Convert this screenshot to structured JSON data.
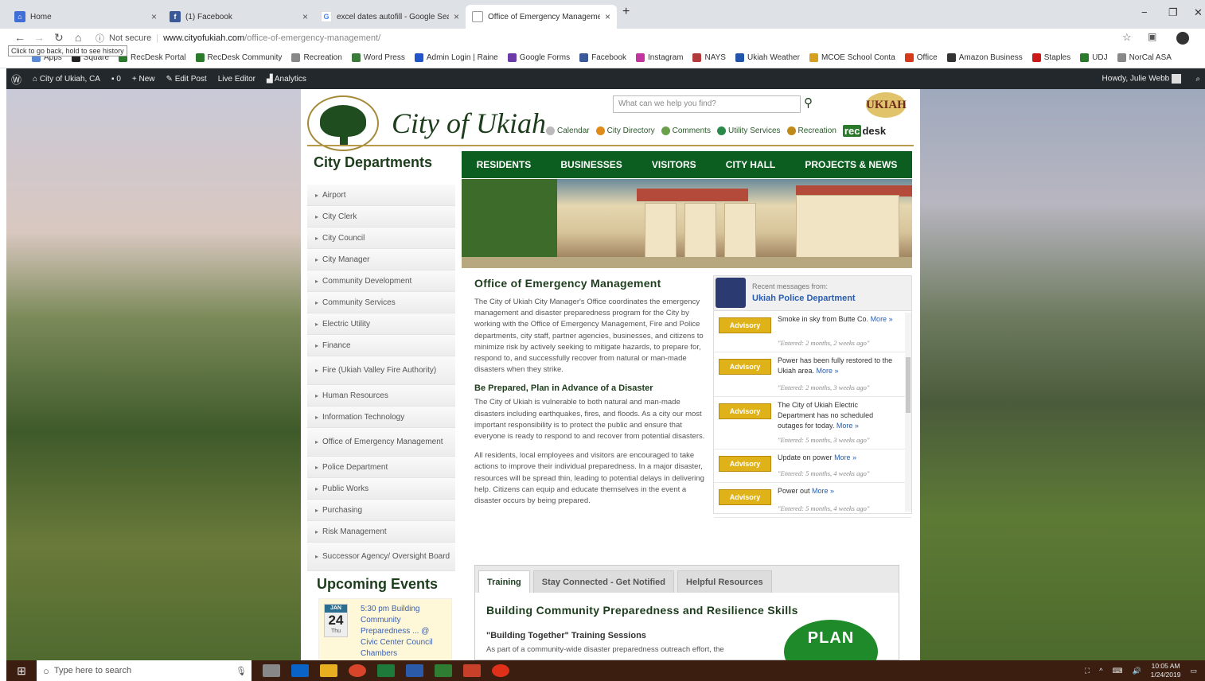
{
  "browser": {
    "tabs": [
      {
        "title": "Home",
        "icon": "home-icon",
        "color": "#3f6fd6"
      },
      {
        "title": "(1) Facebook",
        "icon": "facebook-icon",
        "color": "#3b5998"
      },
      {
        "title": "excel dates autofill - Google Sear",
        "icon": "google-icon",
        "color": "#4285f4"
      },
      {
        "title": "Office of Emergency Manageme",
        "icon": "page-icon",
        "color": "#888888"
      }
    ],
    "new_tab": "+",
    "window_controls": {
      "minimize": "−",
      "restore": "❐",
      "close": "✕"
    },
    "security": "Not secure",
    "url_domain": "www.cityofukiah.com",
    "url_path": "/office-of-emergency-management/",
    "tooltip": "Click to go back, hold to see history",
    "bookmarks": [
      {
        "label": "Apps",
        "color": "#5a8ad6"
      },
      {
        "label": "Square",
        "color": "#222222"
      },
      {
        "label": "RecDesk Portal",
        "color": "#2b7a2b"
      },
      {
        "label": "RecDesk Community",
        "color": "#2b7a2b"
      },
      {
        "label": "Recreation",
        "color": "#888888"
      },
      {
        "label": "Word Press",
        "color": "#3b7a3b"
      },
      {
        "label": "Admin Login | Raine",
        "color": "#2255cc"
      },
      {
        "label": "Google Forms",
        "color": "#6a3aa6"
      },
      {
        "label": "Facebook",
        "color": "#3b5998"
      },
      {
        "label": "Instagram",
        "color": "#c2359f"
      },
      {
        "label": "NAYS",
        "color": "#b33a3a"
      },
      {
        "label": "Ukiah Weather",
        "color": "#2255aa"
      },
      {
        "label": "MCOE School Conta",
        "color": "#d6a020"
      },
      {
        "label": "Office",
        "color": "#d63a1a"
      },
      {
        "label": "Amazon Business",
        "color": "#333333"
      },
      {
        "label": "Staples",
        "color": "#cc1a1a"
      },
      {
        "label": "UDJ",
        "color": "#2b7a2b"
      },
      {
        "label": "NorCal ASA",
        "color": "#888888"
      }
    ]
  },
  "wp_admin": {
    "site": "City of Ukiah, CA",
    "comments": "0",
    "new": "New",
    "edit_post": "Edit Post",
    "live_editor": "Live Editor",
    "analytics": "Analytics",
    "howdy": "Howdy, Julie Webb"
  },
  "header": {
    "site_name": "City of Ukiah",
    "search_placeholder": "What can we help you find?",
    "badge": "UKIAH",
    "quick_links": [
      {
        "label": "Calendar",
        "color": "#bbbbbb"
      },
      {
        "label": "City Directory",
        "color": "#e08a1a"
      },
      {
        "label": "Comments",
        "color": "#6aa04a"
      },
      {
        "label": "Utility Services",
        "color": "#2b8a4a"
      },
      {
        "label": "Recreation",
        "color": "#c08a1a"
      }
    ],
    "recdesk_a": "rec",
    "recdesk_b": "desk"
  },
  "nav": [
    "RESIDENTS",
    "BUSINESSES",
    "VISITORS",
    "CITY HALL",
    "PROJECTS & NEWS"
  ],
  "sidebar": {
    "title": "City Departments",
    "items": [
      "Airport",
      "City Clerk",
      "City Council",
      "City Manager",
      "Community Development",
      "Community Services",
      "Electric Utility",
      "Finance",
      "Fire (Ukiah Valley Fire Authority)",
      "Human Resources",
      "Information Technology",
      "Office of Emergency Management",
      "Police Department",
      "Public Works",
      "Purchasing",
      "Risk Management",
      "Successor Agency/ Oversight Board"
    ]
  },
  "events": {
    "title": "Upcoming Events",
    "month": "JAN",
    "day": "24",
    "weekday": "Thu",
    "text": "5:30 pm Building Community Preparedness ... @ Civic Center Council Chambers"
  },
  "main": {
    "title": "Office of Emergency Management",
    "p1": "The City of Ukiah City Manager's Office coordinates the emergency management and disaster preparedness program for the City by working with the Office of Emergency Management, Fire and Police departments, city staff, partner agencies, businesses, and citizens to minimize risk by actively seeking to mitigate hazards, to prepare for, respond to, and successfully recover from natural or man-made disasters when they strike.",
    "h2": "Be Prepared, Plan in Advance of a Disaster",
    "p2": "The City of Ukiah is vulnerable to both natural and man-made disasters including earthquakes, fires, and floods. As a city our most important responsibility is to protect the public and ensure that everyone is ready to respond to and recover from potential disasters.",
    "p3": "All residents, local employees and visitors are encouraged to take actions to improve their individual preparedness. In a major disaster, resources will be spread thin, leading to potential delays in delivering help. Citizens can equip and educate themselves in the event a disaster occurs by being prepared."
  },
  "feed": {
    "from_label": "Recent messages from:",
    "from_name": "Ukiah Police Department",
    "items": [
      {
        "badge": "Advisory",
        "text": "Smoke in sky from Butte Co.",
        "more": "More »",
        "date": "\"Entered: 2 months, 2 weeks ago\""
      },
      {
        "badge": "Advisory",
        "text": "Power has been fully restored to the Ukiah area.",
        "more": "More »",
        "date": "\"Entered: 2 months, 3 weeks ago\""
      },
      {
        "badge": "Advisory",
        "text": "The City of Ukiah Electric Department has no scheduled outages for today.",
        "more": "More »",
        "date": "\"Entered: 5 months, 3 weeks ago\""
      },
      {
        "badge": "Advisory",
        "text": "Update on power",
        "more": "More »",
        "date": "\"Entered: 5 months, 4 weeks ago\""
      },
      {
        "badge": "Advisory",
        "text": "Power out",
        "more": "More »",
        "date": "\"Entered: 5 months, 4 weeks ago\""
      }
    ]
  },
  "tabs_widget": {
    "tabs": [
      "Training",
      "Stay Connected - Get Notified",
      "Helpful Resources"
    ],
    "heading": "Building Community Preparedness and Resilience Skills",
    "sub": "\"Building Together\" Training Sessions",
    "text": "As part of a community-wide disaster preparedness outreach effort, the",
    "plan": "PLAN"
  },
  "taskbar": {
    "search": "Type here to search",
    "time": "10:05 AM",
    "date": "1/24/2019"
  }
}
